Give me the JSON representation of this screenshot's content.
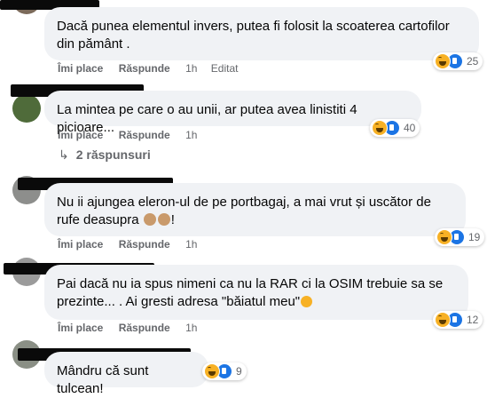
{
  "actions": {
    "like_label": "Îmi place",
    "reply_label": "Răspunde"
  },
  "comments": [
    {
      "text": "Dacă punea elementul invers, putea fi folosit la scoaterea cartofilor din pământ .",
      "time": "1h",
      "edited": "Editat",
      "reaction_count": "25"
    },
    {
      "text": "La mintea pe care o au unii, ar putea avea linistiti 4 picioare...",
      "time": "1h",
      "reaction_count": "40",
      "replies_label": "2 răspunsuri"
    },
    {
      "text": "Nu ii ajungea eleron-ul de pe portbagaj, a mai vrut și uscător de rufe deasupra",
      "text_suffix": "!",
      "time": "1h",
      "reaction_count": "19"
    },
    {
      "text": "Pai dacă nu ia spus nimeni ca nu la RAR ci la OSIM trebuie sa se prezinte... . Ai gresti adresa \"băiatul meu\"",
      "time": "1h",
      "reaction_count": "12"
    },
    {
      "text": "Mândru că sunt tulcean!",
      "reaction_count": "9"
    }
  ],
  "icons": {
    "reaction_primary": "haha-icon",
    "reaction_secondary": "like-icon",
    "reply_arrow": "reply-arrow-icon",
    "emoji_monkey": "see-no-evil-monkey-icon",
    "emoji_rofl": "rofl-icon"
  },
  "colors": {
    "bubble_bg": "#f0f2f5",
    "meta_text": "#65676b",
    "like_blue": "#1b74e4",
    "haha_yellow": "#f7b125"
  }
}
